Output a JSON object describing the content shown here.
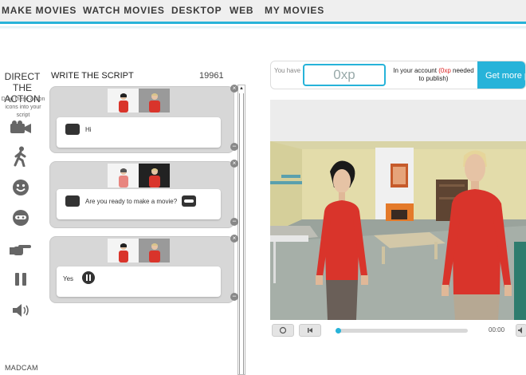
{
  "nav": {
    "items": [
      "MAKE MOVIES",
      "WATCH MOVIES",
      "DESKTOP",
      "WEB",
      "MY MOVIES"
    ]
  },
  "toolbar": {
    "title_line1": "DIRECT",
    "title_line2": "THE ACTION",
    "hint": "Drag these action icons into your script",
    "tools": [
      "camera-icon",
      "walk-icon",
      "smile-icon",
      "mask-icon",
      "point-icon",
      "pause-icon",
      "speaker-icon"
    ],
    "logo": "MADCAM"
  },
  "script": {
    "title": "WRITE THE SCRIPT",
    "count": "19961",
    "lines": [
      {
        "text": "Hi",
        "speaker": "woman",
        "emotion": null
      },
      {
        "text": "Are you ready to make a movie?",
        "speaker": "man",
        "emotion": "mask"
      },
      {
        "text": "Yes",
        "speaker": "woman",
        "emotion": "pause"
      }
    ]
  },
  "account": {
    "you_have": "You have",
    "xp_value": "0xp",
    "in_account": "In your account",
    "required": "(0xp",
    "required2": "needed to publish)",
    "get_more": "Get more p"
  },
  "player": {
    "time": "00:00",
    "progress": 0.0
  },
  "colors": {
    "accent": "#27b3d9",
    "shirt": "#d9342b",
    "wall": "#d9d4a7"
  }
}
